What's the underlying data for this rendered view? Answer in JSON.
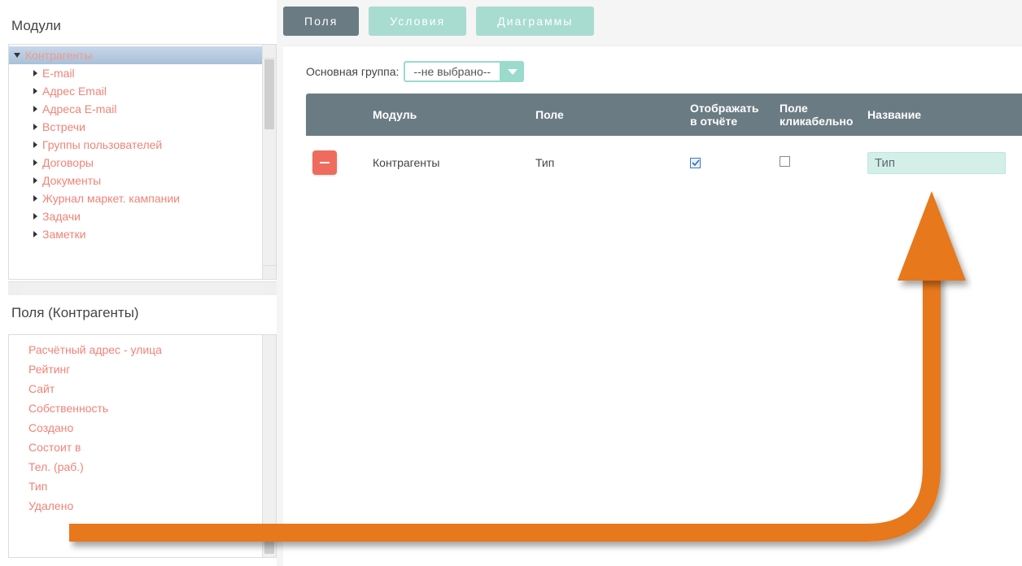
{
  "sidebar": {
    "modules_title": "Модули",
    "root_module": "Контрагенты",
    "child_modules": [
      "E-mail",
      "Адрес Email",
      "Адреса E-mail",
      "Встречи",
      "Группы пользователей",
      "Договоры",
      "Документы",
      "Журнал маркет. кампании",
      "Задачи",
      "Заметки"
    ],
    "fields_title": "Поля (Контрагенты)",
    "fields": [
      "Расчётный адрес - улица",
      "Рейтинг",
      "Сайт",
      "Собственность",
      "Создано",
      "Состоит в",
      "Тел. (раб.)",
      "Тип",
      "Удалено"
    ]
  },
  "tabs": {
    "fields": "Поля",
    "conditions": "Условия",
    "diagrams": "Диаграммы"
  },
  "main_group": {
    "label": "Основная группа:",
    "value": "--не выбрано--"
  },
  "table": {
    "headers": {
      "module": "Модуль",
      "field": "Поле",
      "display": "Отображать в отчёте",
      "clickable": "Поле кликабельно",
      "name": "Название"
    },
    "rows": [
      {
        "module": "Контрагенты",
        "field": "Тип",
        "display_checked": true,
        "clickable_checked": false,
        "name_value": "Тип"
      }
    ]
  }
}
